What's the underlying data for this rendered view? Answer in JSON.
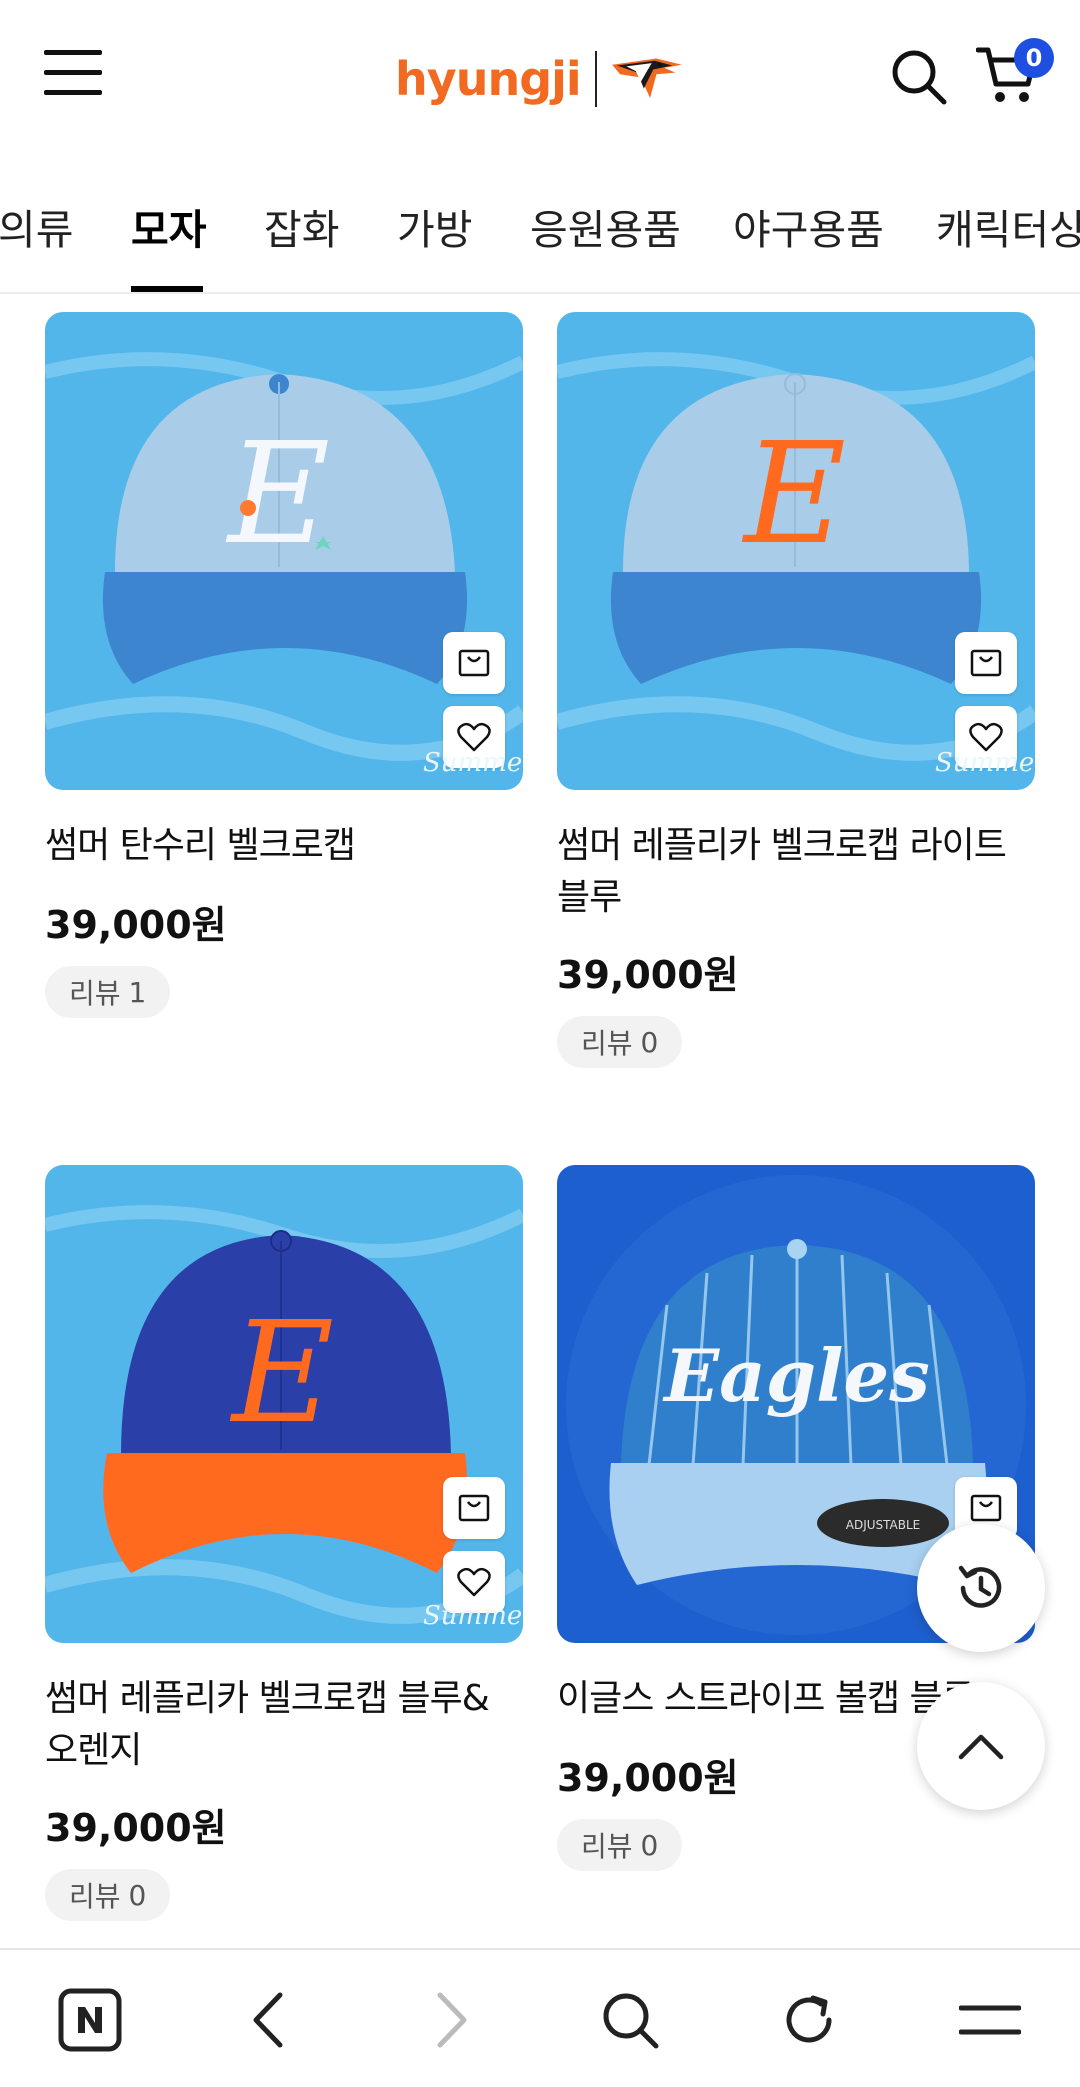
{
  "header": {
    "logo_text": "hyungji",
    "cart_count": "0"
  },
  "tabs": [
    {
      "label": "의류",
      "active": false
    },
    {
      "label": "모자",
      "active": true
    },
    {
      "label": "잡화",
      "active": false
    },
    {
      "label": "가방",
      "active": false
    },
    {
      "label": "응원용품",
      "active": false
    },
    {
      "label": "야구용품",
      "active": false
    },
    {
      "label": "캐릭터상품",
      "active": false
    }
  ],
  "products": [
    {
      "name": "썸머 탄수리 벨크로캡",
      "price": "39,000원",
      "review_label": "리뷰",
      "review_count": "1",
      "badge": "Summer"
    },
    {
      "name": "썸머 레플리카 벨크로캡 라이트 블루",
      "price": "39,000원",
      "review_label": "리뷰",
      "review_count": "0",
      "badge": "Summer"
    },
    {
      "name": "썸머 레플리카 벨크로캡 블루& 오렌지",
      "price": "39,000원",
      "review_label": "리뷰",
      "review_count": "0",
      "badge": "Summer"
    },
    {
      "name": "이글스 스트라이프 볼캡 블루",
      "price": "39,000원",
      "review_label": "리뷰",
      "review_count": "0",
      "cap_text": "Eagles",
      "tag_text": "ADJUSTABLE"
    }
  ],
  "colors": {
    "brand_orange": "#f26a21",
    "badge_blue": "#1e4fe0",
    "summer_bg": "#4fb3e8",
    "cap_light_blue": "#a9cde8",
    "cap_blue": "#3d86cf",
    "cap_navy": "#2a3fa8",
    "cap_orange": "#ff6a1f"
  },
  "icons": {
    "menu": "hamburger-icon",
    "search": "search-icon",
    "cart": "cart-icon",
    "add_to_cart": "shopping-bag-icon",
    "wishlist": "heart-icon",
    "recent": "history-icon",
    "scroll_top": "chevron-up-icon",
    "browser_home": "naver-n-icon",
    "back": "chevron-left-icon",
    "forward": "chevron-right-icon",
    "refresh": "refresh-icon",
    "more": "menu-icon"
  }
}
